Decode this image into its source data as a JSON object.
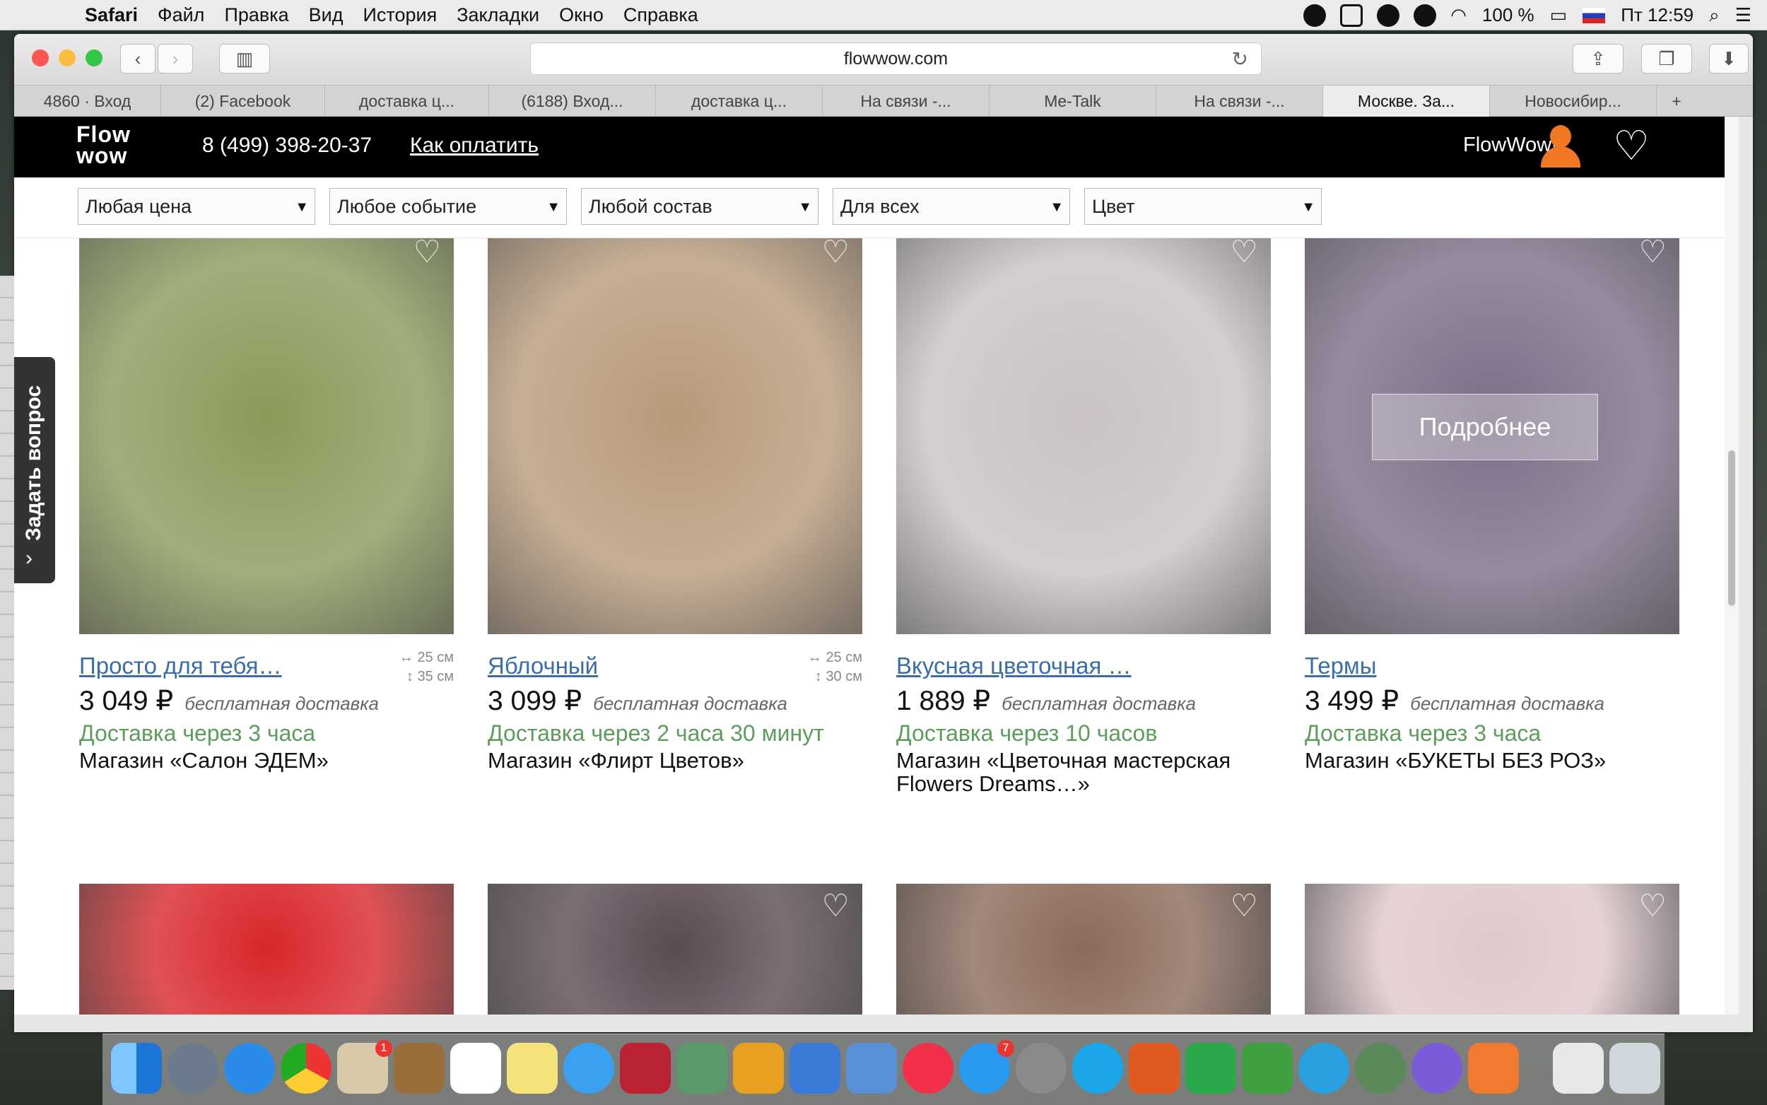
{
  "menubar": {
    "app": "Safari",
    "items": [
      "Файл",
      "Правка",
      "Вид",
      "История",
      "Закладки",
      "Окно",
      "Справка"
    ],
    "battery": "100 %",
    "clock": "Пт 12:59"
  },
  "browser": {
    "url": "flowwow.com",
    "tabs": [
      "4860 · Вход",
      "(2) Facebook",
      "доставка ц...",
      "(6188) Вход...",
      "доставка ц...",
      "На связи -...",
      "Me-Talk",
      "На связи -...",
      "Москве. За...",
      "Новосибир..."
    ],
    "active_tab_index": 8
  },
  "site": {
    "logo_line1": "Flow",
    "logo_line2": "wow",
    "phone": "8 (499) 398-20-37",
    "how_to_pay": "Как оплатить",
    "brand_link": "FlowWow!",
    "ask_question": "Задать вопрос",
    "details_button": "Подробнее"
  },
  "filters": [
    "Любая цена",
    "Любое событие",
    "Любой состав",
    "Для всех",
    "Цвет"
  ],
  "products": [
    {
      "name": "Просто для тебя…",
      "width": "25 см",
      "height": "35 см",
      "price": "3 049 ₽",
      "delivery_note": "бесплатная доставка",
      "eta": "Доставка через 3 часа",
      "shop": "Магазин «Салон ЭДЕМ»",
      "img_color": "#8a9a5a"
    },
    {
      "name": "Яблочный",
      "width": "25 см",
      "height": "30 см",
      "price": "3 099 ₽",
      "delivery_note": "бесплатная доставка",
      "eta": "Доставка через 2 часа 30 минут",
      "shop": "Магазин «Флирт Цветов»",
      "img_color": "#b89a7a"
    },
    {
      "name": "Вкусная цветочная …",
      "width": "",
      "height": "",
      "price": "1 889 ₽",
      "delivery_note": "бесплатная доставка",
      "eta": "Доставка через 10 часов",
      "shop": "Магазин «Цветочная мастерская Flowers Dreams…»",
      "img_color": "#c9c2c6"
    },
    {
      "name": "Термы",
      "width": "",
      "height": "",
      "price": "3 499 ₽",
      "delivery_note": "бесплатная доставка",
      "eta": "Доставка через 3 часа",
      "shop": "Магазин «БУКЕТЫ БЕЗ РОЗ»",
      "img_color": "#7c6e88"
    }
  ],
  "products_row2_colors": [
    "#d8262a",
    "#5a4a52",
    "#8b6a5a",
    "#e0c8cc"
  ]
}
